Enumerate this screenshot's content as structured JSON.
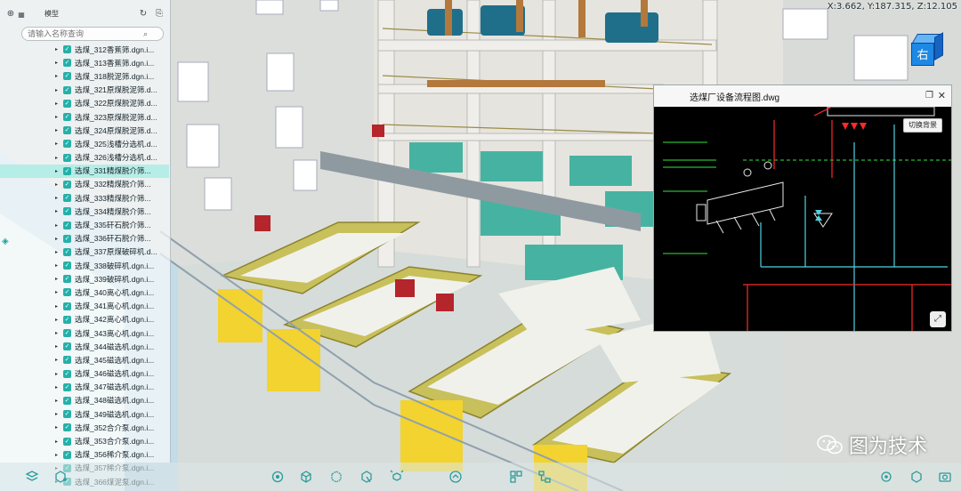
{
  "coords": {
    "text": "X:3.662, Y:187.315, Z:12.105"
  },
  "viewcube": {
    "face_label": "右"
  },
  "tree": {
    "title": "模型",
    "search_placeholder": "请输入名称查询",
    "items": [
      {
        "label": "选煤_312香蕉筛.dgn.i..."
      },
      {
        "label": "选煤_313香蕉筛.dgn.i..."
      },
      {
        "label": "选煤_318脱泥筛.dgn.i..."
      },
      {
        "label": "选煤_321原煤脱泥筛.d..."
      },
      {
        "label": "选煤_322原煤脱泥筛.d..."
      },
      {
        "label": "选煤_323原煤脱泥筛.d..."
      },
      {
        "label": "选煤_324原煤脱泥筛.d..."
      },
      {
        "label": "选煤_325浅槽分选机.d..."
      },
      {
        "label": "选煤_326浅槽分选机.d..."
      },
      {
        "label": "选煤_331精煤脱介筛...",
        "selected": true
      },
      {
        "label": "选煤_332精煤脱介筛..."
      },
      {
        "label": "选煤_333精煤脱介筛..."
      },
      {
        "label": "选煤_334精煤脱介筛..."
      },
      {
        "label": "选煤_335矸石脱介筛..."
      },
      {
        "label": "选煤_336矸石脱介筛..."
      },
      {
        "label": "选煤_337原煤破碎机.d..."
      },
      {
        "label": "选煤_338破碎机.dgn.i..."
      },
      {
        "label": "选煤_339破碎机.dgn.i..."
      },
      {
        "label": "选煤_340离心机.dgn.i..."
      },
      {
        "label": "选煤_341离心机.dgn.i..."
      },
      {
        "label": "选煤_342离心机.dgn.i..."
      },
      {
        "label": "选煤_343离心机.dgn.i..."
      },
      {
        "label": "选煤_344磁选机.dgn.i..."
      },
      {
        "label": "选煤_345磁选机.dgn.i..."
      },
      {
        "label": "选煤_346磁选机.dgn.i..."
      },
      {
        "label": "选煤_347磁选机.dgn.i..."
      },
      {
        "label": "选煤_348磁选机.dgn.i..."
      },
      {
        "label": "选煤_349磁选机.dgn.i..."
      },
      {
        "label": "选煤_352合介泵.dgn.i..."
      },
      {
        "label": "选煤_353合介泵.dgn.i..."
      },
      {
        "label": "选煤_356稀介泵.dgn.i..."
      },
      {
        "label": "选煤_357稀介泵.dgn.i..."
      },
      {
        "label": "选煤_366煤泥泵.dgn.i..."
      }
    ]
  },
  "viewer": {
    "title": "选煤厂设备流程图.dwg",
    "switch_bg_label": "切换背景"
  },
  "watermark": {
    "text": "图为技术"
  },
  "colors": {
    "accent": "#25b0a8",
    "cad_bg": "#000000",
    "cad_green": "#2ee83a",
    "cad_red": "#ff2a2a",
    "cad_cyan": "#4fd3e0"
  }
}
